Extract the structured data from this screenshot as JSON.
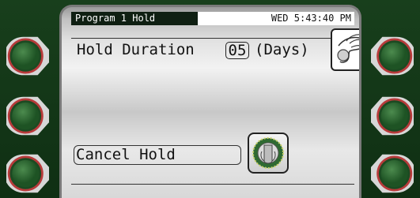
{
  "header": {
    "title": "Program 1 Hold",
    "clock": "WED 5:43:40 PM"
  },
  "hold": {
    "label": "Hold Duration",
    "value": "05",
    "unit": "(Days)"
  },
  "cancel": {
    "label": "Cancel Hold"
  },
  "colors": {
    "bezel": "#143818",
    "button_ring": "#c0392b",
    "button_face": "#2f6a32"
  },
  "icons": {
    "adjust": "hand-turning-knob-icon",
    "knob": "rotary-knob-icon"
  }
}
